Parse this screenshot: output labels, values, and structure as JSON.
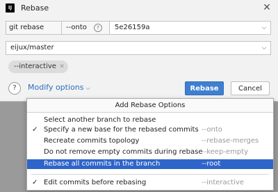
{
  "window": {
    "title": "Rebase",
    "app_icon": "intellij-icon",
    "app_icon_text": "IJ"
  },
  "row1": {
    "command": "git rebase",
    "onto": "--onto",
    "help_glyph": "?",
    "hash": "5e26159a"
  },
  "row2": {
    "value": "eijux/master"
  },
  "chip": {
    "label": "--interactive",
    "close_glyph": "✕"
  },
  "footer": {
    "help_glyph": "?",
    "modify_label": "Modify options",
    "rebase_label": "Rebase",
    "cancel_label": "Cancel"
  },
  "menu": {
    "header": "Add Rebase Options",
    "items": [
      {
        "label": "Select another branch to rebase",
        "option": "",
        "checked": false,
        "selected": false
      },
      {
        "label": "Specify a new base for the rebased commits",
        "option": "--onto",
        "checked": true,
        "selected": false
      },
      {
        "label": "Recreate commits topology",
        "option": "--rebase-merges",
        "checked": false,
        "selected": false
      },
      {
        "label": "Do not remove empty commits during rebase",
        "option": "--keep-empty",
        "checked": false,
        "selected": false
      },
      {
        "label": "Rebase all commits in the branch",
        "option": "--root",
        "checked": false,
        "selected": true
      },
      {
        "label": "Edit commits before rebasing",
        "option": "--interactive",
        "checked": true,
        "selected": false
      }
    ],
    "check_glyph": "✓"
  },
  "colors": {
    "accent": "#3f7fd0",
    "selection": "#2f65ca",
    "link": "#2a6fb8"
  }
}
